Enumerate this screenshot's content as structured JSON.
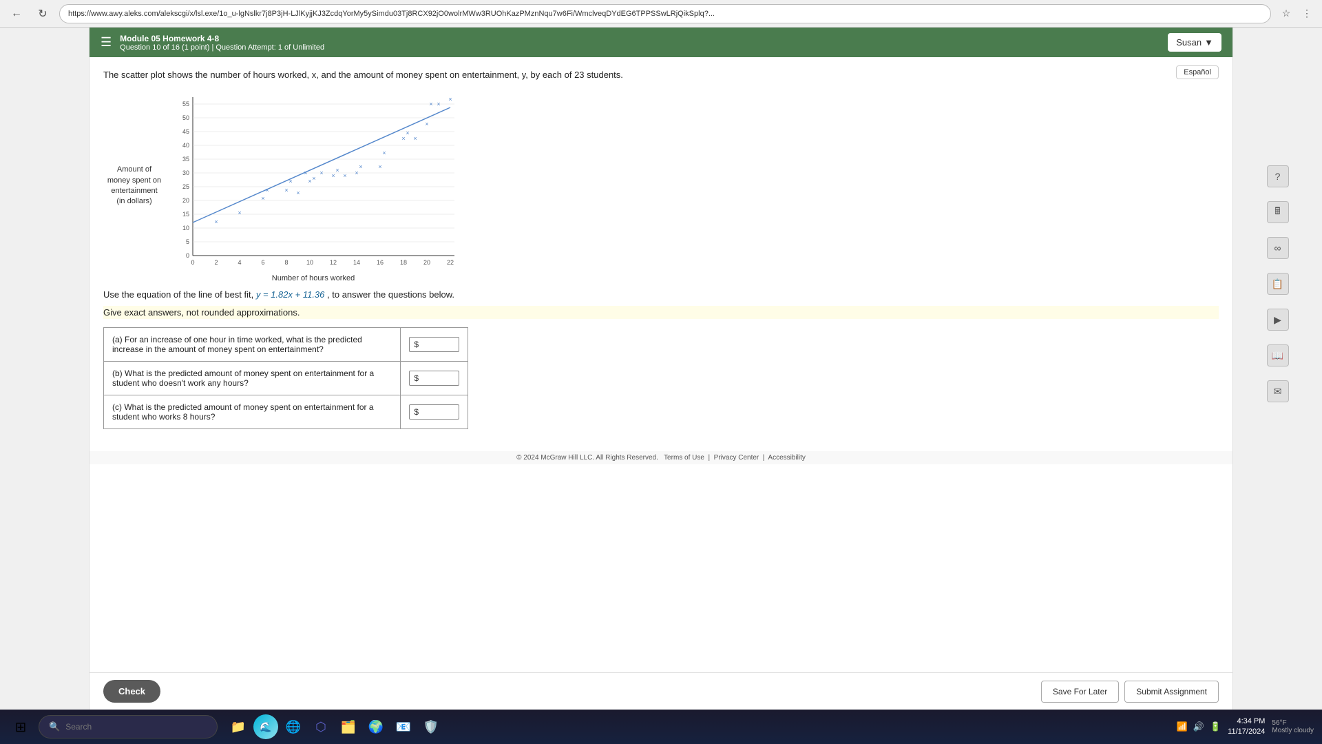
{
  "browser": {
    "url": "https://www.awy.aleks.com/alekscgi/x/lsl.exe/1o_u-lgNslkr7j8P3jH-LJlKyjjKJ3ZcdqYorMy5ySimdu03Tj8RCX92jO0wolrMWw3RUOhKazPMznNqu7w6Fi/WmclveqDYdEG6TPPSSwLRjQikSplq?...",
    "back_label": "←",
    "refresh_label": "↻"
  },
  "header": {
    "module_title": "Module 05 Homework 4-8",
    "question_info": "Question 10 of 16 (1 point)  |  Question Attempt: 1 of Unlimited",
    "user_label": "Susan",
    "espanol_label": "Español",
    "hamburger": "☰"
  },
  "question": {
    "text": "The scatter plot shows the number of hours worked, x, and the amount of money spent on entertainment, y, by each of 23 students.",
    "y_axis_label": "Amount of\nmoney spent on\nentertainment\n(in dollars)",
    "x_axis_label": "Number of hours worked",
    "equation_text_before": "Use the equation of the line of best fit,",
    "equation": "y = 1.82x + 11.36",
    "equation_text_after": ", to answer the questions below.",
    "give_text": "Give exact answers, not rounded approximations.",
    "parts": [
      {
        "id": "a",
        "question": "(a) For an increase of one hour in time worked, what is the predicted increase in the amount of money spent on entertainment?",
        "prefix": "$"
      },
      {
        "id": "b",
        "question": "(b) What is the predicted amount of money spent on entertainment for a student who doesn't work any hours?",
        "prefix": "$"
      },
      {
        "id": "c",
        "question": "(c) What is the predicted amount of money spent on entertainment for a student who works 8 hours?",
        "prefix": "$"
      }
    ]
  },
  "buttons": {
    "check": "Check",
    "save_later": "Save For Later",
    "submit": "Submit Assignment"
  },
  "footer": {
    "copyright": "© 2024 McGraw Hill LLC. All Rights Reserved.",
    "terms": "Terms of Use",
    "privacy": "Privacy Center",
    "accessibility": "Accessibility"
  },
  "taskbar": {
    "search_placeholder": "Search",
    "time": "4:34 PM",
    "date": "11/17/2024",
    "weather": "56°F\nMostly cloudy"
  },
  "chart": {
    "y_ticks": [
      0,
      5,
      10,
      15,
      20,
      25,
      30,
      35,
      40,
      45,
      50,
      55
    ],
    "x_ticks": [
      0,
      2,
      4,
      6,
      8,
      10,
      12,
      14,
      16,
      18,
      20,
      22
    ],
    "data_points": [
      [
        2,
        12
      ],
      [
        4,
        15
      ],
      [
        6,
        20
      ],
      [
        6,
        22
      ],
      [
        8,
        22
      ],
      [
        8,
        25
      ],
      [
        9,
        21
      ],
      [
        10,
        25
      ],
      [
        10,
        26
      ],
      [
        10,
        28
      ],
      [
        11,
        28
      ],
      [
        12,
        27
      ],
      [
        12,
        29
      ],
      [
        13,
        27
      ],
      [
        14,
        28
      ],
      [
        14,
        30
      ],
      [
        16,
        30
      ],
      [
        16,
        35
      ],
      [
        18,
        40
      ],
      [
        18,
        42
      ],
      [
        19,
        40
      ],
      [
        20,
        45
      ],
      [
        20,
        52
      ],
      [
        21,
        52
      ],
      [
        22,
        55
      ]
    ],
    "line_start": [
      0,
      11.36
    ],
    "line_end": [
      22,
      51.4
    ]
  },
  "sidebar_icons": [
    "?",
    "🖩",
    "∞",
    "📋",
    "▶",
    "📖",
    "✉"
  ]
}
